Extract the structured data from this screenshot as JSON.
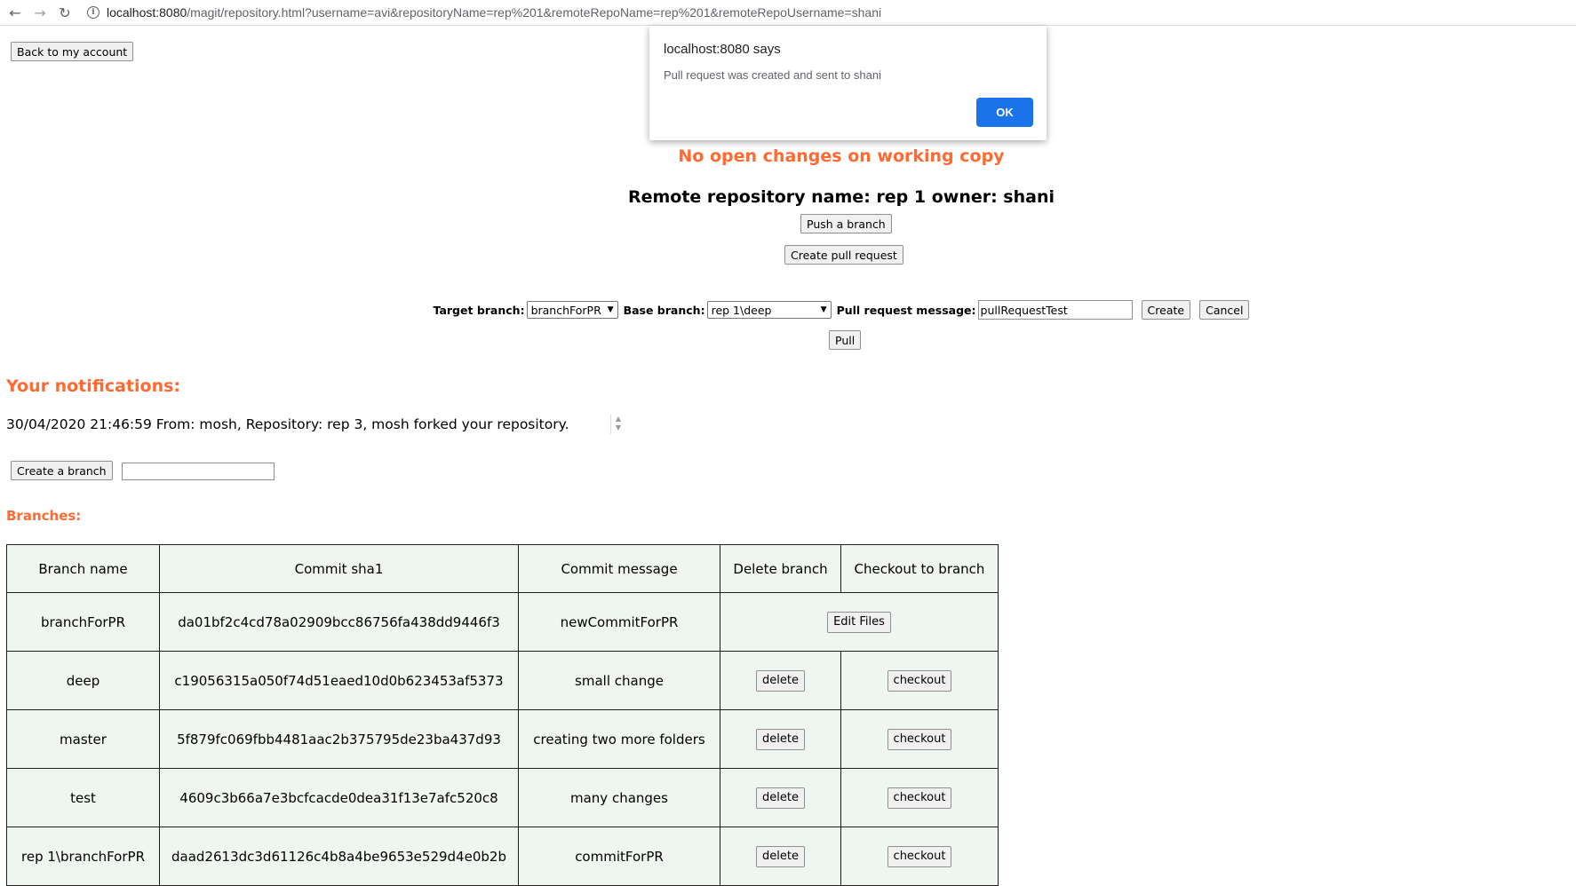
{
  "browser": {
    "url_host": "localhost:8080",
    "url_path": "/magit/repository.html?username=avi&repositoryName=rep%201&remoteRepoName=rep%201&remoteRepoUsername=shani"
  },
  "back_button": "Back to my account",
  "status_message": "No open changes on working copy",
  "remote_repo_line": "Remote repository name: rep 1 owner: shani",
  "push_branch_button": "Push a branch",
  "create_pr_button": "Create pull request",
  "pr_form": {
    "target_label": "Target branch:",
    "target_value": "branchForPR",
    "base_label": "Base branch:",
    "base_value": "rep 1\\deep",
    "message_label": "Pull request message:",
    "message_value": "pullRequestTest",
    "create_label": "Create",
    "cancel_label": "Cancel"
  },
  "pull_button": "Pull",
  "notifications": {
    "title": "Your notifications:",
    "text": "30/04/2020 21:46:59 From: mosh, Repository: rep 3, mosh forked your repository."
  },
  "create_branch_button": "Create a branch",
  "create_branch_input": "",
  "branches": {
    "title": "Branches:",
    "headers": [
      "Branch name",
      "Commit sha1",
      "Commit message",
      "Delete branch",
      "Checkout to branch"
    ],
    "edit_files_label": "Edit Files",
    "delete_label": "delete",
    "checkout_label": "checkout",
    "rows": [
      {
        "name": "branchForPR",
        "sha1": "da01bf2c4cd78a02909bcc86756fa438dd9446f3",
        "message": "newCommitForPR"
      },
      {
        "name": "deep",
        "sha1": "c19056315a050f74d51eaed10d0b623453af5373",
        "message": "small change"
      },
      {
        "name": "master",
        "sha1": "5f879fc069fbb4481aac2b375795de23ba437d93",
        "message": "creating two more folders"
      },
      {
        "name": "test",
        "sha1": "4609c3b66a7e3bcfcacde0dea31f13e7afc520c8",
        "message": "many changes"
      },
      {
        "name": "rep 1\\branchForPR",
        "sha1": "daad2613dc3d61126c4b8a4be9653e529d4e0b2b",
        "message": "commitForPR"
      }
    ]
  },
  "alert": {
    "title": "localhost:8080 says",
    "message": "Pull request was created and sent to shani",
    "ok_label": "OK"
  },
  "colors": {
    "accent": "#ff6a33",
    "table_bg": "#eef6ef",
    "ok_blue": "#1a73e8"
  }
}
